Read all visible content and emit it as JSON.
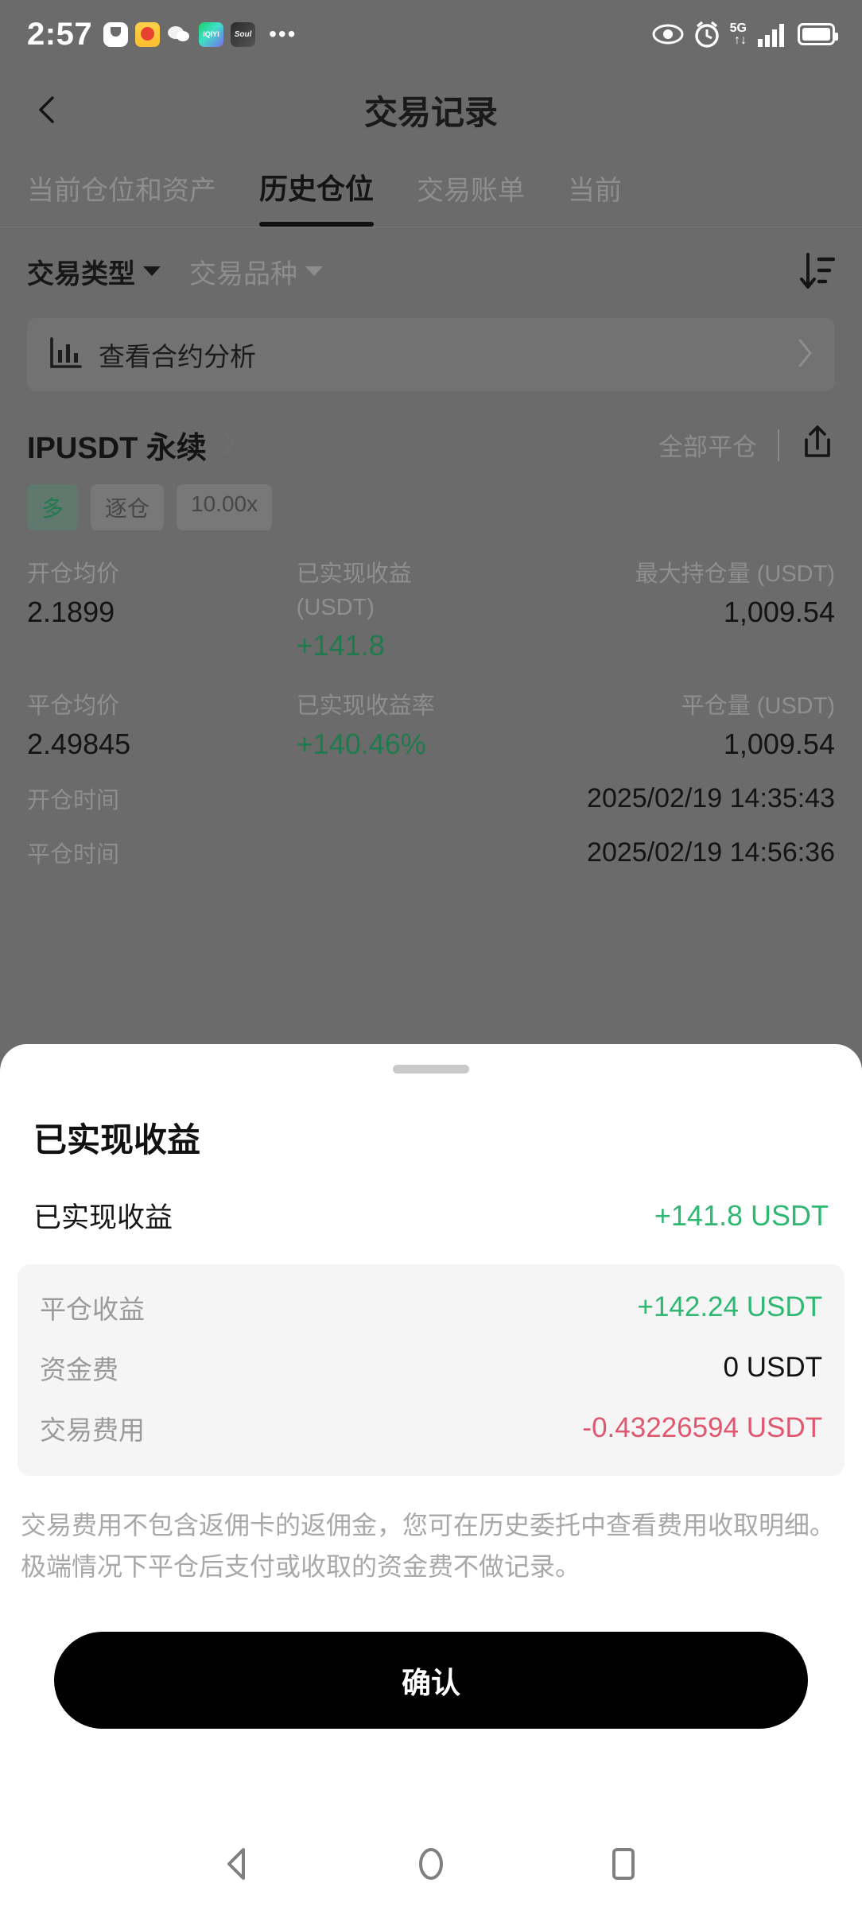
{
  "status_bar": {
    "time": "2:57",
    "app_icons": [
      "tuya-icon",
      "weibo-icon",
      "wechat-icon",
      "iqiyi-icon",
      "soul-icon"
    ],
    "iqiyi_text": "iQIYI",
    "soul_text": "Soul",
    "overflow": "•••",
    "right_icons": [
      "eye-icon",
      "alarm-icon",
      "signal-icon",
      "battery-icon"
    ],
    "network": "5G",
    "network_sub": "↑↓"
  },
  "header": {
    "title": "交易记录",
    "back_icon": "back-chevron-icon"
  },
  "tabs": [
    {
      "label": "当前仓位和资产",
      "active": false
    },
    {
      "label": "历史仓位",
      "active": true
    },
    {
      "label": "交易账单",
      "active": false
    },
    {
      "label": "当前",
      "active": false
    }
  ],
  "filters": {
    "trade_type": "交易类型",
    "trade_symbol": "交易品种",
    "sort_icon": "sort-descending-icon"
  },
  "analysis_banner": {
    "icon": "bar-chart-icon",
    "label": "查看合约分析",
    "chevron": "chevron-right-icon"
  },
  "position": {
    "symbol": "IPUSDT 永续",
    "chevron": "chevron-right-icon",
    "closed_label": "全部平仓",
    "share_icon": "share-upload-icon",
    "tags": [
      "多",
      "逐仓",
      "10.00x"
    ],
    "metrics": [
      {
        "label": "开仓均价",
        "value": "2.1899"
      },
      {
        "label": "已实现收益 (USDT)",
        "label_line1": "已实现收益",
        "label_line2": "(USDT)",
        "value": "+141.8"
      },
      {
        "label": "最大持仓量 (USDT)",
        "value": "1,009.54"
      },
      {
        "label": "平仓均价",
        "value": "2.49845"
      },
      {
        "label": "已实现收益率",
        "value": "+140.46%"
      },
      {
        "label": "平仓量 (USDT)",
        "value": "1,009.54"
      }
    ],
    "open_time_label": "开仓时间",
    "open_time_value": "2025/02/19 14:35:43",
    "close_time_label": "平仓时间",
    "close_time_value": "2025/02/19 14:56:36"
  },
  "sheet": {
    "title": "已实现收益",
    "summary": {
      "label": "已实现收益",
      "value": "+141.8 USDT"
    },
    "breakdown": [
      {
        "label": "平仓收益",
        "value": "+142.24 USDT",
        "tone": "green"
      },
      {
        "label": "资金费",
        "value": "0 USDT",
        "tone": "dark"
      },
      {
        "label": "交易费用",
        "value": "-0.43226594 USDT",
        "tone": "red"
      }
    ],
    "disclaimer": "交易费用不包含返佣卡的返佣金，您可在历史委托中查看费用收取明细。极端情况下平仓后支付或收取的资金费不做记录。",
    "confirm_label": "确认"
  },
  "nav_bar": {
    "back": "nav-back-icon",
    "home": "nav-home-icon",
    "recents": "nav-recents-icon"
  },
  "colors": {
    "green": "#2eb872",
    "red": "#e0576f",
    "overlay": "#6b6b6b",
    "panel": "#f5f5f5",
    "accent_black": "#000000"
  }
}
